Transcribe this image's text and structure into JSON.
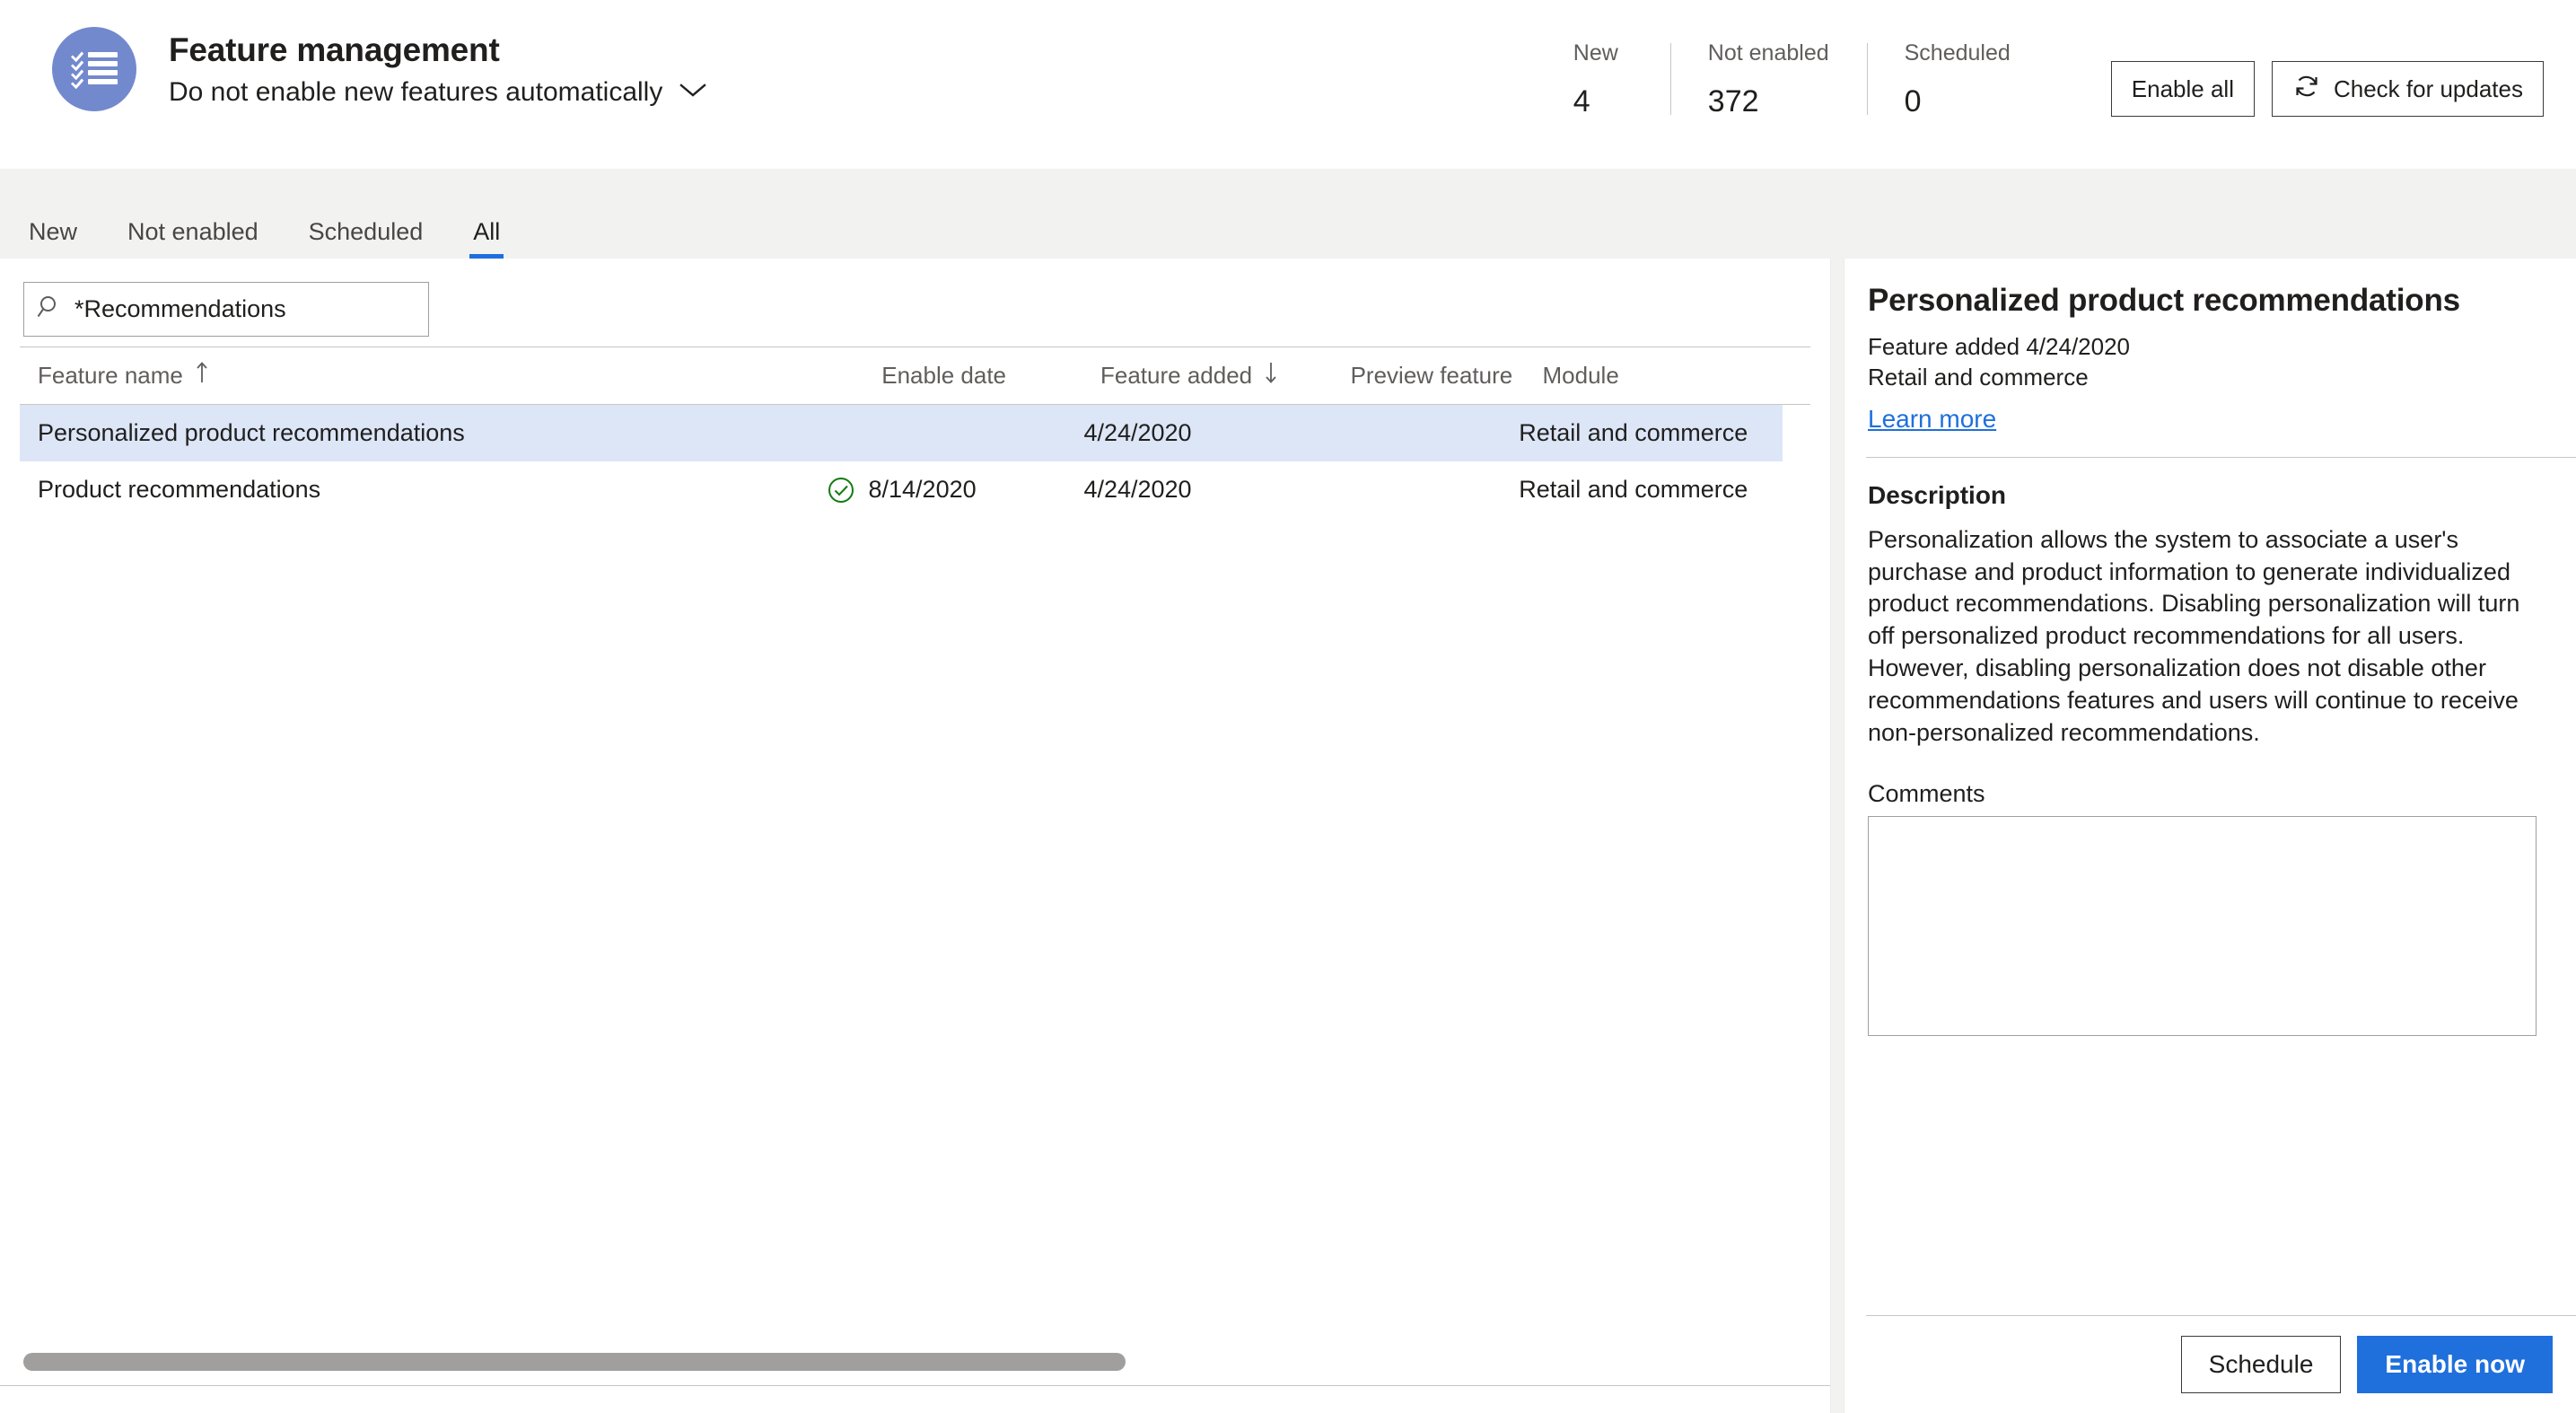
{
  "header": {
    "icon": "checklist-icon",
    "title": "Feature management",
    "subtitle": "Do not enable new features automatically",
    "chevron_icon": "chevron-down-icon",
    "stats": [
      {
        "label": "New",
        "value": "4"
      },
      {
        "label": "Not enabled",
        "value": "372"
      },
      {
        "label": "Scheduled",
        "value": "0"
      }
    ],
    "buttons": {
      "enable_all": "Enable all",
      "check_for_updates": "Check for updates",
      "refresh_icon": "refresh-icon"
    }
  },
  "tabs": [
    {
      "label": "New",
      "active": false
    },
    {
      "label": "Not enabled",
      "active": false
    },
    {
      "label": "Scheduled",
      "active": false
    },
    {
      "label": "All",
      "active": true
    }
  ],
  "search": {
    "icon": "search-icon",
    "value": "*Recommendations",
    "placeholder": "Filter"
  },
  "grid": {
    "columns": [
      {
        "label": "Feature name",
        "sort": "ascending",
        "sort_glyph": "↑"
      },
      {
        "label": ""
      },
      {
        "label": "Enable date"
      },
      {
        "label": "Feature added",
        "sort": "descending",
        "sort_glyph": "↓"
      },
      {
        "label": "Preview feature"
      },
      {
        "label": "Module"
      }
    ],
    "rows": [
      {
        "name": "Personalized product recommendations",
        "status_icon": "",
        "enable_date": "",
        "feature_added": "4/24/2020",
        "preview_feature": "",
        "module": "Retail and commerce",
        "selected": true
      },
      {
        "name": "Product recommendations",
        "status_icon": "check-circle-icon",
        "enable_date": "8/14/2020",
        "feature_added": "4/24/2020",
        "preview_feature": "",
        "module": "Retail and commerce",
        "selected": false
      }
    ],
    "scrollbar": "horizontal-scrollbar"
  },
  "detail": {
    "title": "Personalized product recommendations",
    "added_line": "Feature added 4/24/2020",
    "module_line": "Retail and commerce",
    "learn_more": "Learn more",
    "description_label": "Description",
    "description": "Personalization allows the system to associate a user's purchase and product information to generate individualized product recommendations. Disabling personalization will turn off personalized product recommendations for all users. However, disabling personalization does not disable other recommendations features and users will continue to receive non-personalized recommendations.",
    "comments_label": "Comments",
    "comments_value": "",
    "comments_placeholder": "",
    "schedule_button": "Schedule",
    "enable_now_button": "Enable now"
  },
  "colors": {
    "accent": "#1f6fdc",
    "icon_circle": "#7389ce",
    "selected_row": "#dce6f7",
    "status_green": "#107c10",
    "page_background": "#f2f2f1"
  }
}
